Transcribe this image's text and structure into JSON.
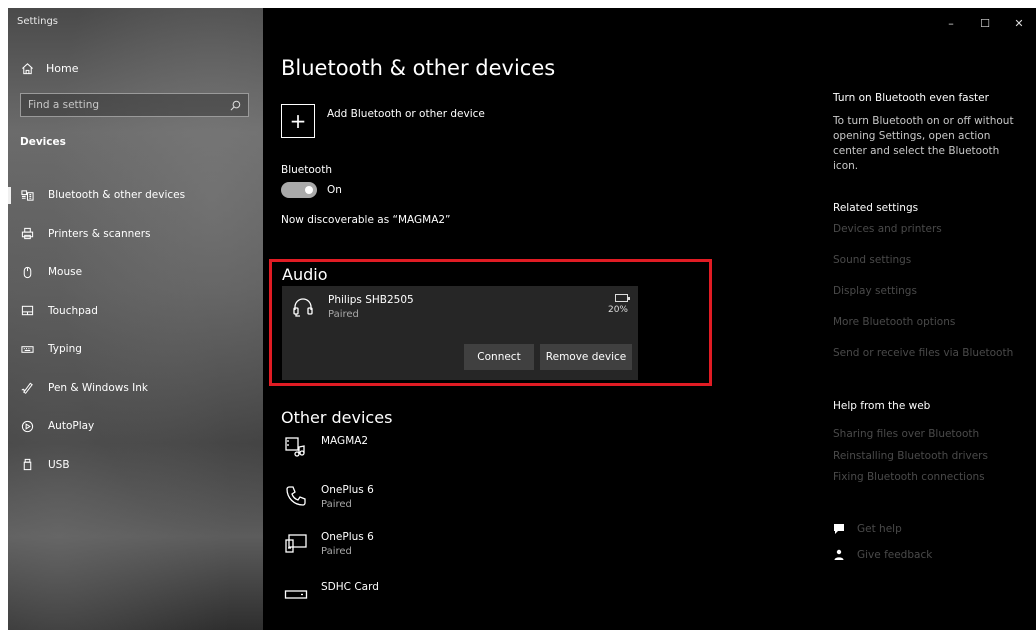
{
  "window": {
    "title": "Settings",
    "minimize": "–",
    "maximize": "☐",
    "close": "✕"
  },
  "sidebar": {
    "home_label": "Home",
    "search_placeholder": "Find a setting",
    "section_label": "Devices",
    "items": [
      {
        "label": "Bluetooth & other devices",
        "icon": "bluetooth-devices-icon",
        "active": true
      },
      {
        "label": "Printers & scanners",
        "icon": "printer-icon"
      },
      {
        "label": "Mouse",
        "icon": "mouse-icon"
      },
      {
        "label": "Touchpad",
        "icon": "touchpad-icon"
      },
      {
        "label": "Typing",
        "icon": "keyboard-icon"
      },
      {
        "label": "Pen & Windows Ink",
        "icon": "pen-icon"
      },
      {
        "label": "AutoPlay",
        "icon": "autoplay-icon"
      },
      {
        "label": "USB",
        "icon": "usb-icon"
      }
    ]
  },
  "main": {
    "title": "Bluetooth & other devices",
    "add_label": "Add Bluetooth or other device",
    "bluetooth_label": "Bluetooth",
    "toggle_state": "On",
    "discoverable": "Now discoverable as “MAGMA2”",
    "audio": {
      "title": "Audio",
      "device_name": "Philips SHB2505",
      "device_status": "Paired",
      "battery": "20%",
      "connect_label": "Connect",
      "remove_label": "Remove device"
    },
    "other": {
      "title": "Other devices",
      "items": [
        {
          "name": "MAGMA2",
          "sub": "",
          "icon": "multimedia-device-icon"
        },
        {
          "name": "OnePlus 6",
          "sub": "Paired",
          "icon": "phone-icon"
        },
        {
          "name": "OnePlus 6",
          "sub": "Paired",
          "icon": "phone-device-icon"
        },
        {
          "name": "SDHC Card",
          "sub": "",
          "icon": "drive-icon"
        }
      ]
    }
  },
  "right": {
    "faster_title": "Turn on Bluetooth even faster",
    "faster_text": "To turn Bluetooth on or off without opening Settings, open action center and select the Bluetooth icon.",
    "related_title": "Related settings",
    "related_links": [
      "Devices and printers",
      "Sound settings",
      "Display settings",
      "More Bluetooth options",
      "Send or receive files via Bluetooth"
    ],
    "web_title": "Help from the web",
    "web_links": [
      "Sharing files over Bluetooth",
      "Reinstalling Bluetooth drivers",
      "Fixing Bluetooth connections"
    ],
    "get_help": "Get help",
    "give_feedback": "Give feedback"
  }
}
